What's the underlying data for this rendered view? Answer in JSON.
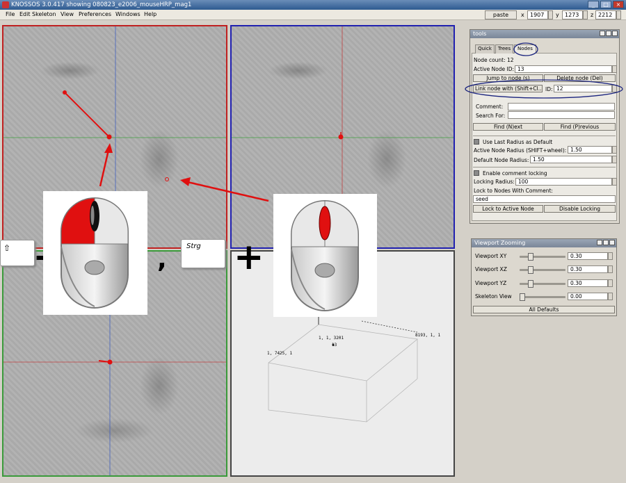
{
  "window": {
    "title": "KNOSSOS 3.0.417 showing 080823_e2006_mouseHRP_mag1"
  },
  "menu": [
    "File",
    "Edit Skeleton",
    "View",
    "Preferences",
    "Windows",
    "Help"
  ],
  "toolbar": {
    "paste_label": "paste",
    "x_label": "x",
    "x_value": "1907",
    "y_label": "y",
    "y_value": "1273",
    "z_label": "z",
    "z_value": "2212"
  },
  "skeleton_view": {
    "labels": [
      "1, 1, 3201",
      "13",
      "1, 7425, 1",
      "8193, 1, 1"
    ]
  },
  "overlay": {
    "shift_key_glyph": "⇧",
    "strg_key_label": "Strg",
    "plus": "+",
    "comma": ","
  },
  "tools": {
    "title": "tools",
    "tabs": [
      "Quick",
      "Trees",
      "Nodes"
    ],
    "active_tab": "Nodes",
    "node_count_label": "Node count: 12",
    "active_node_label": "Active Node ID:",
    "active_node_value": "13",
    "jump_button": "Jump to node (s)",
    "delete_button": "Delete node (Del)",
    "link_button": "Link node with (Shift+Cl...",
    "id_label": "ID:",
    "id_value": "12",
    "comment_label": "Comment:",
    "comment_value": "",
    "search_label": "Search For:",
    "search_value": "",
    "find_next": "Find (N)ext",
    "find_prev": "Find (P)revious",
    "use_last_radius": "Use Last Radius as Default",
    "active_radius_label": "Active Node Radius (SHIFT+wheel):",
    "active_radius_value": "1.50",
    "default_radius_label": "Default Node Radius:",
    "default_radius_value": "1.50",
    "enable_locking": "Enable comment locking",
    "locking_radius_label": "Locking Radius:",
    "locking_radius_value": "100",
    "lock_comment_label": "Lock to Nodes With Comment:",
    "lock_comment_value": "seed",
    "lock_active_button": "Lock to Active Node",
    "disable_locking_button": "Disable Locking"
  },
  "zoom": {
    "title": "Viewport Zooming",
    "rows": [
      {
        "label": "Viewport XY",
        "value": "0.30",
        "level": 0.3
      },
      {
        "label": "Viewport XZ",
        "value": "0.30",
        "level": 0.3
      },
      {
        "label": "Viewport YZ",
        "value": "0.30",
        "level": 0.3
      },
      {
        "label": "Skeleton View",
        "value": "0.00",
        "level": 0.0
      }
    ],
    "all_defaults": "All Defaults"
  },
  "colors": {
    "xy_border": "#c02020",
    "xz_border": "#2020b0",
    "yz_border": "#3a9a3a",
    "node_red": "#e01010",
    "highlight_blue": "#1a237e"
  }
}
